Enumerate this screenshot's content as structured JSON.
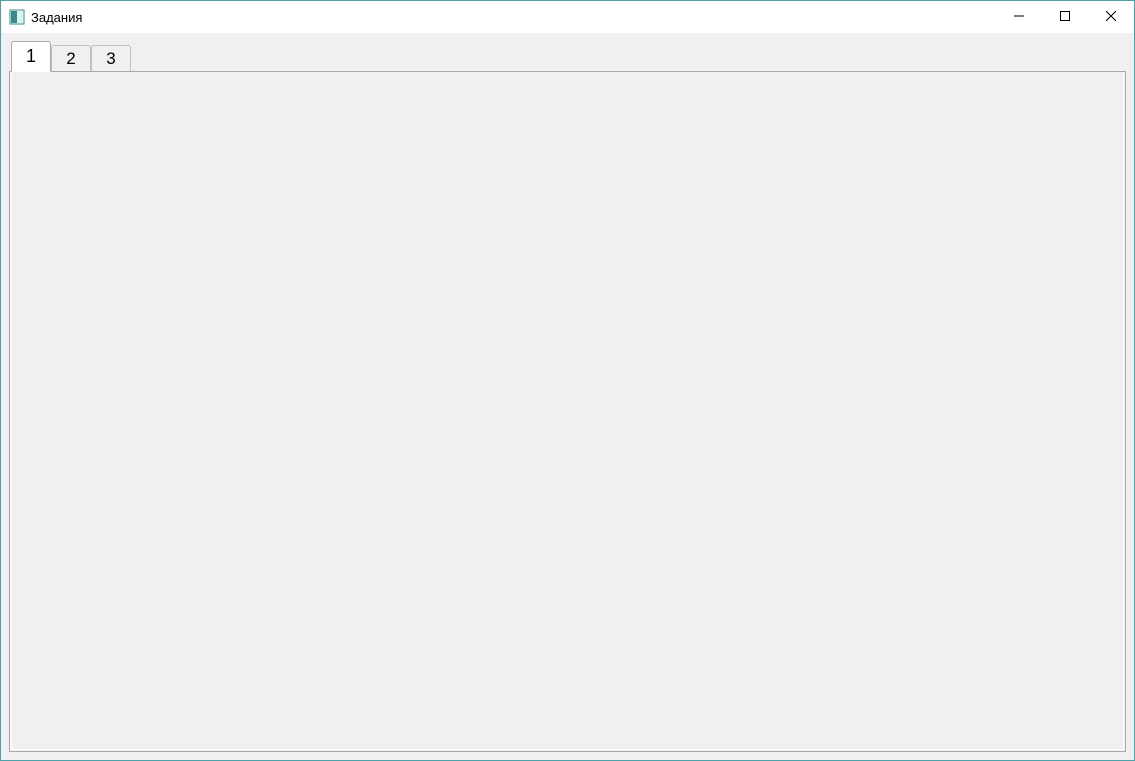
{
  "window": {
    "title": "Задания"
  },
  "tabs": {
    "items": [
      {
        "label": "1",
        "active": true
      },
      {
        "label": "2",
        "active": false
      },
      {
        "label": "3",
        "active": false
      }
    ]
  }
}
